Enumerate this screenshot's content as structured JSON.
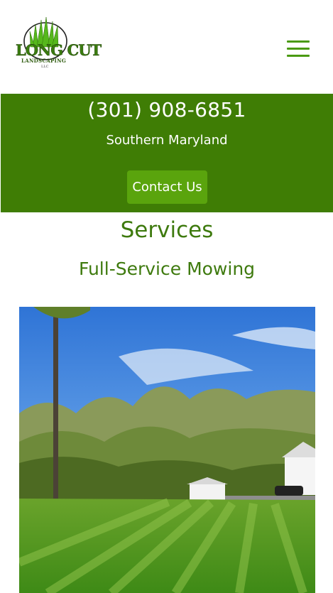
{
  "logo": {
    "line1": "LONG CUT",
    "line2": "LANDSCAPING",
    "line3": "LLC"
  },
  "menu": {
    "icon": "hamburger-icon"
  },
  "banner": {
    "phone": "(301) 908-6851",
    "region": "Southern Maryland",
    "contact_label": "Contact Us",
    "bg_color": "#3f7d05",
    "button_color": "#5aa40d"
  },
  "main": {
    "heading": "Services",
    "subheading": "Full-Service Mowing",
    "accent_color": "#3e7a0e"
  }
}
